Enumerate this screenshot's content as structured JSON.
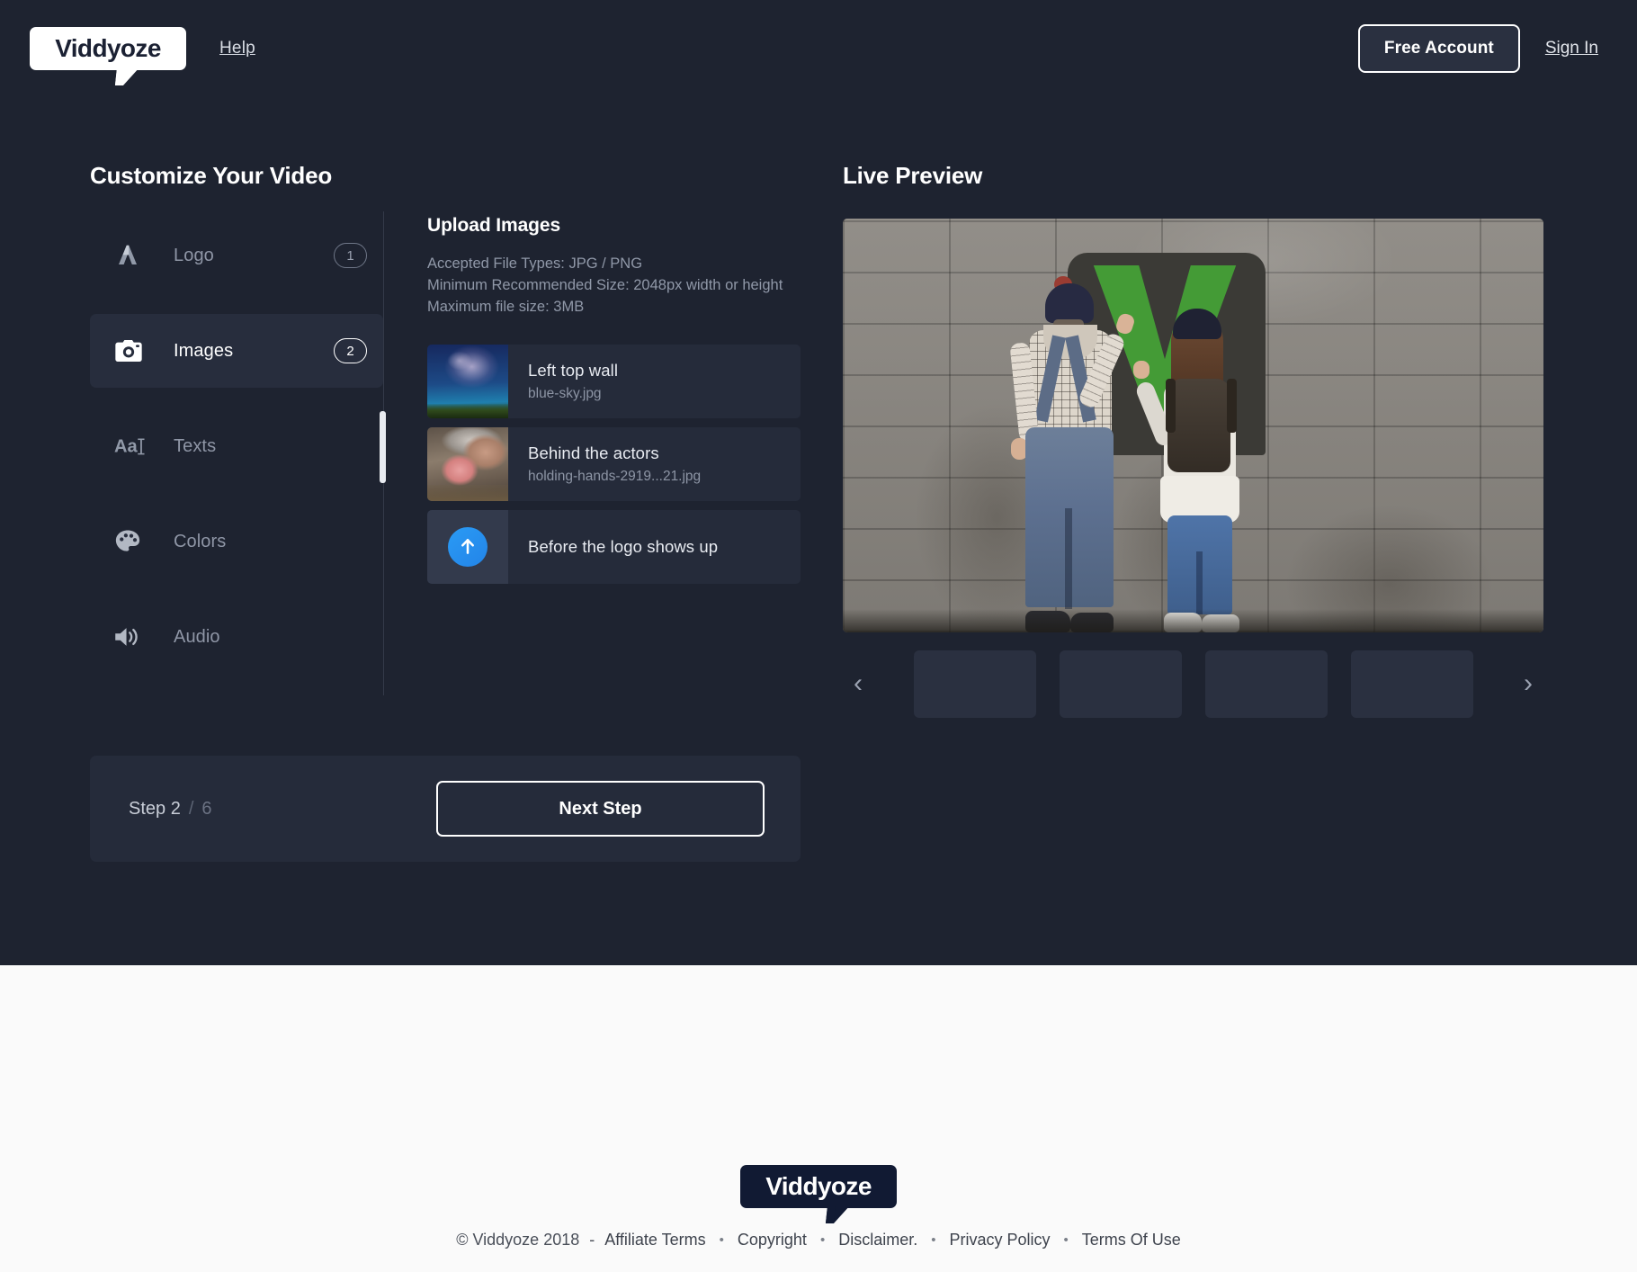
{
  "header": {
    "logo_text": "Viddyoze",
    "help_label": "Help",
    "free_account_label": "Free Account",
    "sign_in_label": "Sign In"
  },
  "customize": {
    "title": "Customize Your Video",
    "nav": [
      {
        "label": "Logo",
        "badge": "1",
        "icon": "logo-mark-icon",
        "active": false
      },
      {
        "label": "Images",
        "badge": "2",
        "icon": "camera-icon",
        "active": true
      },
      {
        "label": "Texts",
        "badge": "",
        "icon": "text-aa-icon",
        "active": false
      },
      {
        "label": "Colors",
        "badge": "",
        "icon": "palette-icon",
        "active": false
      },
      {
        "label": "Audio",
        "badge": "",
        "icon": "speaker-icon",
        "active": false
      }
    ],
    "upload": {
      "title": "Upload Images",
      "accepted_types": "Accepted File Types: JPG / PNG",
      "min_size": "Minimum Recommended Size: 2048px width or height",
      "max_size": "Maximum file size: 3MB",
      "items": [
        {
          "title": "Left top wall",
          "filename": "blue-sky.jpg",
          "thumb": "night-sky-thumbnail"
        },
        {
          "title": "Behind the actors",
          "filename": "holding-hands-2919...21.jpg",
          "thumb": "holding-hands-thumbnail"
        },
        {
          "title": "Before the logo shows up",
          "filename": "",
          "thumb": "upload-arrow-icon"
        }
      ]
    },
    "step": {
      "current_label": "Step 2",
      "separator": "/",
      "total": "6",
      "next_label": "Next Step"
    }
  },
  "preview": {
    "title": "Live Preview",
    "scene_description": "Two people painting a green V on a concrete block wall",
    "prev_icon": "chevron-left-icon",
    "next_icon": "chevron-right-icon",
    "thumbnails": [
      "",
      "",
      "",
      ""
    ]
  },
  "footer": {
    "logo_text": "Viddyoze",
    "copyright": "© Viddyoze 2018",
    "dash": "-",
    "links": [
      "Affiliate Terms",
      "Copyright",
      "Disclaimer.",
      "Privacy Policy",
      "Terms Of Use"
    ],
    "separator": "•"
  },
  "colors": {
    "app_bg": "#1e2330",
    "panel_bg": "#252b3a",
    "active_nav": "#272d3d",
    "accent_blue": "#2a9bf5",
    "graffiti_green": "#44a037",
    "footer_bg": "#fafafa"
  }
}
